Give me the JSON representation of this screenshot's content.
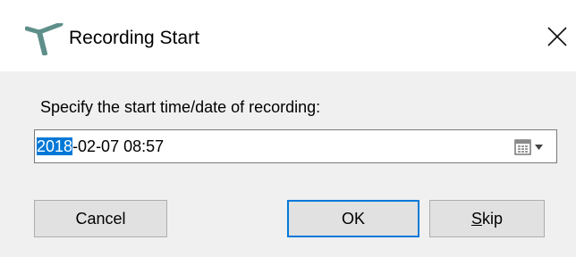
{
  "window": {
    "title": "Recording Start",
    "app_icon": "slingshot-app-icon",
    "close_icon": "close-icon"
  },
  "form": {
    "prompt": "Specify the start time/date of recording:",
    "datetime": {
      "selected_part": "2018",
      "rest": "-02-07 08:57",
      "calendar_icon": "calendar-dropdown-icon"
    }
  },
  "buttons": {
    "cancel_label": "Cancel",
    "ok_label": "OK",
    "skip_label_mnemonic": "S",
    "skip_label_rest": "kip"
  },
  "colors": {
    "selection": "#0078d7",
    "default_button_border": "#0078d7",
    "content_background": "#f0f0f0",
    "app_icon": "#5f8f8a"
  }
}
